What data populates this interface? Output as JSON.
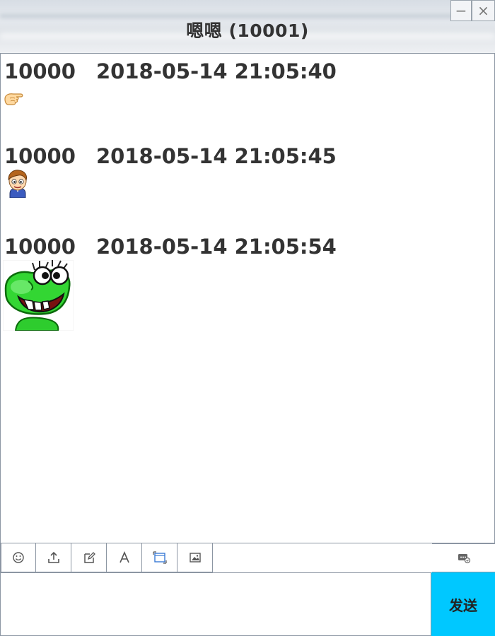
{
  "window": {
    "title": "嗯嗯 (10001)",
    "minimize_glyph": "−",
    "close_glyph": "×"
  },
  "messages": [
    {
      "sender": "10000",
      "time": "2018-05-14 21:05:40",
      "emoji": "pointing-hand-icon"
    },
    {
      "sender": "10000",
      "time": "2018-05-14 21:05:45",
      "emoji": "boy-face-icon"
    },
    {
      "sender": "10000",
      "time": "2018-05-14 21:05:54",
      "emoji": "green-frog-face-icon"
    }
  ],
  "toolbar": {
    "buttons": [
      "smiley-icon",
      "upload-icon",
      "edit-icon",
      "font-icon",
      "screenshot-icon",
      "image-icon"
    ],
    "right_button": "message-record-icon"
  },
  "input": {
    "value": ""
  },
  "send": {
    "label": "发送"
  },
  "colors": {
    "send_button": "#00c8ff",
    "border": "#8c96a3",
    "text": "#333333"
  }
}
